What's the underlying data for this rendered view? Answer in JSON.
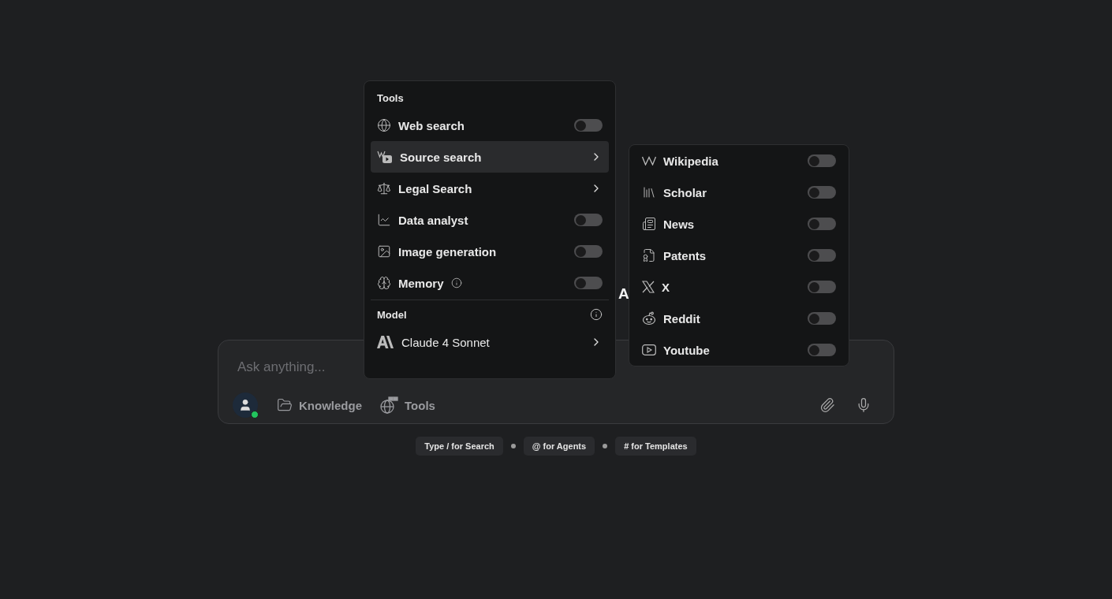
{
  "heading": "A",
  "composer": {
    "placeholder": "Ask anything...",
    "status_online": true,
    "buttons": [
      {
        "kind": "knowledge",
        "label": "Knowledge"
      },
      {
        "kind": "tools",
        "label": "Tools"
      }
    ]
  },
  "hints": [
    "Type / for Search",
    "@ for Agents",
    "# for Templates"
  ],
  "tools_menu": {
    "heading": "Tools",
    "items": [
      {
        "kind": "toggle",
        "label": "Web search",
        "on": false,
        "selected": false
      },
      {
        "kind": "submenu",
        "label": "Source search",
        "selected": true
      },
      {
        "kind": "submenu",
        "label": "Legal Search",
        "selected": false
      },
      {
        "kind": "toggle",
        "label": "Data analyst",
        "on": false,
        "selected": false
      },
      {
        "kind": "toggle",
        "label": "Image generation",
        "on": false,
        "selected": false
      },
      {
        "kind": "toggle",
        "label": "Memory",
        "info": true,
        "on": false,
        "selected": false
      }
    ],
    "model_heading": "Model",
    "model": {
      "label": "Claude 4 Sonnet"
    }
  },
  "source_menu": {
    "items": [
      {
        "label": "Wikipedia",
        "on": false
      },
      {
        "label": "Scholar",
        "on": false
      },
      {
        "label": "News",
        "on": false
      },
      {
        "label": "Patents",
        "on": false
      },
      {
        "label": "X",
        "on": false
      },
      {
        "label": "Reddit",
        "on": false
      },
      {
        "label": "Youtube",
        "on": false
      }
    ]
  }
}
